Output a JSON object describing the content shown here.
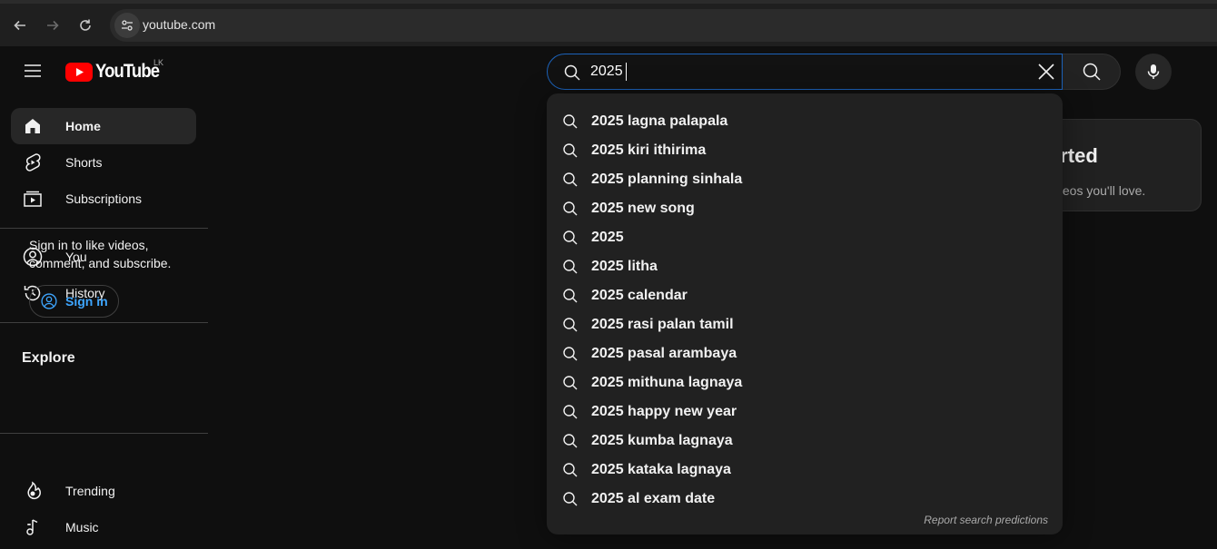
{
  "browser": {
    "url": "youtube.com"
  },
  "masthead": {
    "logo_text": "YouTube",
    "country_code": "LK",
    "search_value": "2025",
    "colors": {
      "brand_red": "#ff0000",
      "focus_blue": "#1c62b9",
      "link_blue": "#3ea6ff"
    }
  },
  "sidebar": {
    "top_items": [
      {
        "label": "Home",
        "icon": "home-icon",
        "active": true
      },
      {
        "label": "Shorts",
        "icon": "shorts-icon"
      },
      {
        "label": "Subscriptions",
        "icon": "subscriptions-icon"
      }
    ],
    "you_items": [
      {
        "label": "You",
        "icon": "account-icon"
      },
      {
        "label": "History",
        "icon": "history-icon"
      }
    ],
    "signin_prompt": "Sign in to like videos, comment, and subscribe.",
    "signin_label": "Sign in",
    "explore_title": "Explore",
    "explore_items": [
      {
        "label": "Trending",
        "icon": "trending-icon"
      },
      {
        "label": "Music",
        "icon": "music-icon"
      }
    ]
  },
  "card": {
    "title_fragment": "arted",
    "subtitle_fragment": "ideos you'll love."
  },
  "suggestions": {
    "items": [
      "2025 lagna palapala",
      "2025 kiri ithirima",
      "2025 planning sinhala",
      "2025 new song",
      "2025",
      "2025 litha",
      "2025 calendar",
      "2025 rasi palan tamil",
      "2025 pasal arambaya",
      "2025 mithuna lagnaya",
      "2025 happy new year",
      "2025 kumba lagnaya",
      "2025 kataka lagnaya",
      "2025 al exam date"
    ],
    "report_label": "Report search predictions"
  }
}
